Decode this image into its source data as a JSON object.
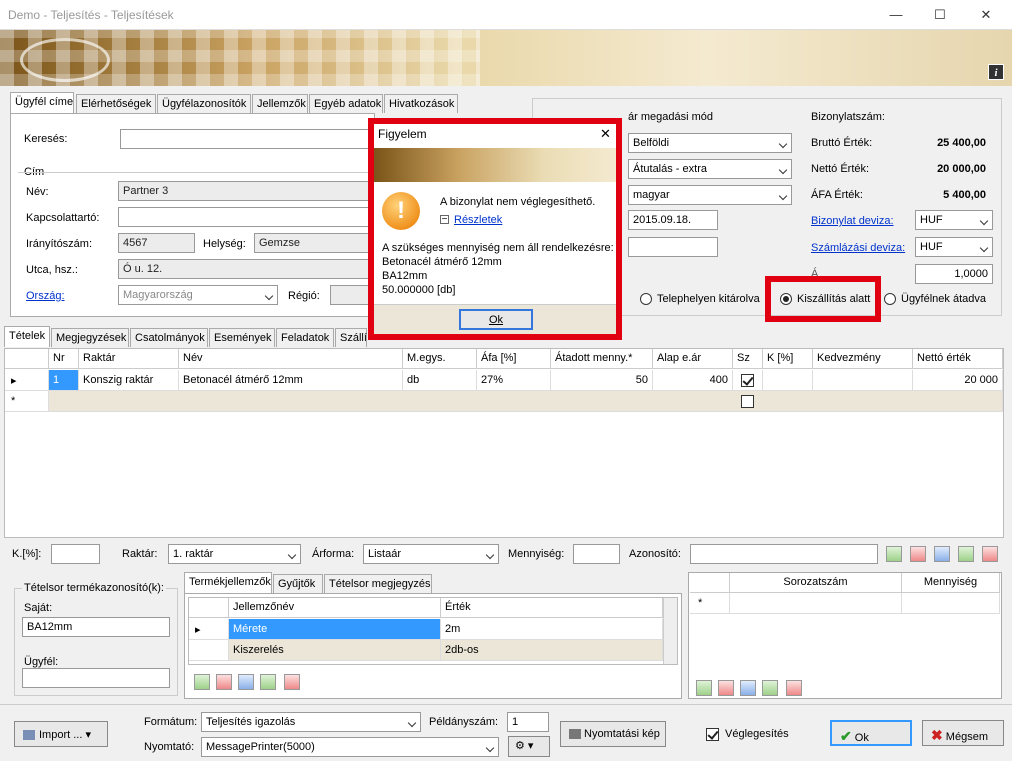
{
  "window": {
    "title": "Demo - Teljesítés - Teljesítések",
    "minimize": "—",
    "maximize": "☐",
    "close": "✕"
  },
  "banner": {
    "info_icon": "info-icon"
  },
  "top_tabs": [
    "Ügyfél címe",
    "Elérhetőségek",
    "Ügyfélazonosítók",
    "Jellemzők",
    "Egyéb adatok",
    "Hivatkozások"
  ],
  "customer": {
    "search_label": "Keresés:",
    "search_value": "",
    "address_group": "Cím",
    "name_label": "Név:",
    "name_value": "Partner 3",
    "contact_label": "Kapcsolattartó:",
    "contact_value": "",
    "zip_label": "Irányítószám:",
    "zip_value": "4567",
    "city_label": "Helység:",
    "city_value": "Gemzse",
    "street_label": "Utca, hsz.:",
    "street_value": "Ó u. 12.",
    "country_label": "Ország:",
    "country_value": "Magyarország",
    "region_label": "Régió:",
    "region_value": ""
  },
  "document": {
    "payment_label": "ár megadási mód",
    "market_value": "Belföldi",
    "payment_method_value": "Átutalás - extra",
    "language_value": "magyar",
    "date_value": "2015.09.18.",
    "extra_value": "",
    "number_label": "Bizonylatszám:",
    "number_value": "",
    "gross_label": "Bruttó Érték:",
    "gross_value": "25 400,00",
    "net_label": "Nettó Érték:",
    "net_value": "20 000,00",
    "vat_label": "ÁFA Érték:",
    "vat_value": "5 400,00",
    "currency_label": "Bizonylat deviza:",
    "currency_value": "HUF",
    "invoice_currency_label": "Számlázási deviza:",
    "invoice_currency_value": "HUF",
    "rate_label": "Á",
    "rate_value": "1,0000",
    "status_options": [
      "Telephelyen kitárolva",
      "Kiszállítás alatt",
      "Ügyfélnek átadva"
    ],
    "status_selected": "Kiszállítás alatt"
  },
  "dialog": {
    "title": "Figyelem",
    "close": "✕",
    "message": "A bizonylat nem véglegesíthető.",
    "details_link": "Részletek",
    "detail_lines": [
      "A szükséges mennyiség nem áll rendelkezésre:",
      "Betonacél átmérő 12mm",
      "BA12mm",
      "50.000000 [db]"
    ],
    "ok_label": "Ok"
  },
  "lower_tabs": [
    "Tételek",
    "Megjegyzések",
    "Csatolmányok",
    "Események",
    "Feladatok",
    "Szállí"
  ],
  "items_grid": {
    "headers": [
      "Nr",
      "Raktár",
      "Név",
      "M.egys.",
      "Áfa [%]",
      "Átadott menny.*",
      "Alap e.ár",
      "Sz",
      "K [%]",
      "Kedvezmény",
      "Nettó érték"
    ],
    "rows": [
      {
        "marker": "▸",
        "nr": "1",
        "warehouse": "Konszig raktár",
        "name": "Betonacél átmérő 12mm",
        "unit": "db",
        "vat": "27%",
        "qty": "50",
        "price": "400",
        "discount_pct": "",
        "discount": "",
        "net": "20 000"
      }
    ],
    "new_row_marker": "*"
  },
  "filter_bar": {
    "k_label": "K.[%]:",
    "k_value": "",
    "warehouse_label": "Raktár:",
    "warehouse_value": "1. raktár",
    "priceform_label": "Árforma:",
    "priceform_value": "Listaár",
    "qty_label": "Mennyiség:",
    "qty_value": "",
    "id_label": "Azonosító:",
    "id_value": ""
  },
  "product_ids": {
    "group_title": "Tételsor termékazonosító(k):",
    "own_label": "Saját:",
    "own_value": "BA12mm",
    "customer_label": "Ügyfél:",
    "customer_value": ""
  },
  "props_tabs": [
    "Termékjellemzők",
    "Gyűjtők",
    "Tételsor megjegyzés"
  ],
  "props_grid": {
    "headers": [
      "Jellemzőnév",
      "Érték"
    ],
    "rows": [
      {
        "name": "Mérete",
        "value": "2m"
      },
      {
        "name": "Kiszerelés",
        "value": "2db-os"
      }
    ]
  },
  "serial_grid": {
    "headers": [
      "Sorozatszám",
      "Mennyiség"
    ],
    "new_row_marker": "*"
  },
  "footer": {
    "import_label": "Import ...",
    "format_label": "Formátum:",
    "format_value": "Teljesítés igazolás",
    "copies_label": "Példányszám:",
    "copies_value": "1",
    "printer_label": "Nyomtató:",
    "printer_value": "MessagePrinter(5000)",
    "preview_label": "Nyomtatási kép",
    "finalize_label": "Véglegesítés",
    "ok_label": "Ok",
    "cancel_label": "Mégsem"
  },
  "colors": {
    "highlight": "#e00012",
    "selection": "#3399ff",
    "link": "#0033cc"
  }
}
